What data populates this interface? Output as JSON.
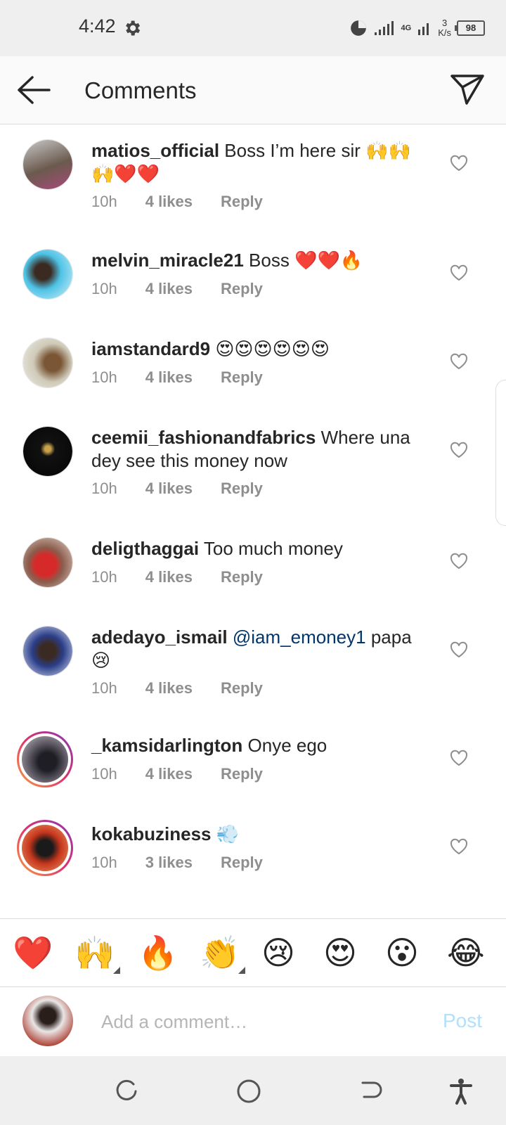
{
  "status": {
    "time": "4:42",
    "network": "4G",
    "speed_value": "3",
    "speed_unit": "K/s",
    "battery": "98"
  },
  "header": {
    "title": "Comments"
  },
  "comments": [
    {
      "username": "matios_official",
      "text": "Boss I’m here sir 🙌🙌🙌❤️❤️",
      "mention": "",
      "time": "10h",
      "likes": "4 likes",
      "reply": "Reply"
    },
    {
      "username": "melvin_miracle21",
      "text": "Boss ❤️❤️🔥",
      "mention": "",
      "time": "10h",
      "likes": "4 likes",
      "reply": "Reply"
    },
    {
      "username": "iamstandard9",
      "text": "😍😍😍😍😍😍",
      "mention": "",
      "time": "10h",
      "likes": "4 likes",
      "reply": "Reply"
    },
    {
      "username": "ceemii_fashionandfabrics",
      "text": "Where una dey see this money now",
      "mention": "",
      "time": "10h",
      "likes": "4 likes",
      "reply": "Reply"
    },
    {
      "username": "deligthaggai",
      "text": "Too much  money",
      "mention": "",
      "time": "10h",
      "likes": "4 likes",
      "reply": "Reply"
    },
    {
      "username": "adedayo_ismail",
      "text": "papa 😢",
      "mention": "@iam_emoney1",
      "time": "10h",
      "likes": "4 likes",
      "reply": "Reply"
    },
    {
      "username": "_kamsidarlington",
      "text": "Onye ego",
      "mention": "",
      "time": "10h",
      "likes": "4 likes",
      "reply": "Reply"
    },
    {
      "username": "kokabuziness",
      "text": "💨",
      "mention": "",
      "time": "10h",
      "likes": "3 likes",
      "reply": "Reply"
    }
  ],
  "emoji_bar": [
    "❤️",
    "🙌",
    "🔥",
    "👏",
    "😢",
    "😍",
    "😮",
    "😂"
  ],
  "composer": {
    "placeholder": "Add a comment…",
    "post_label": "Post"
  },
  "colors": {
    "accent_post_disabled": "#b2dffc",
    "mention": "#003569",
    "meta_gray": "#8e8e8e"
  }
}
